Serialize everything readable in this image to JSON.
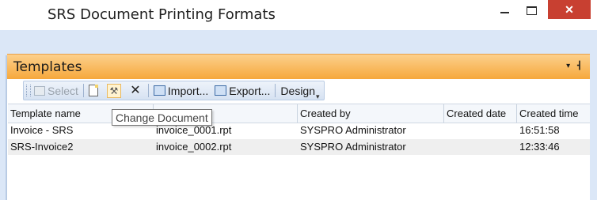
{
  "window": {
    "title": "SRS Document Printing Formats",
    "minimize_label": "",
    "maximize_label": "",
    "close_label": "✕"
  },
  "panel": {
    "title": "Templates",
    "pin_label": "▾ ⊢"
  },
  "toolbar": {
    "select_label": "Select",
    "import_label": "Import...",
    "export_label": "Export...",
    "design_label": "Design"
  },
  "tooltip": {
    "text": "Change Document"
  },
  "grid": {
    "columns": [
      "Template name",
      "",
      "Created by",
      "Created date",
      "Created time"
    ],
    "rows": [
      {
        "template_name": "Invoice - SRS",
        "file": "invoice_0001.rpt",
        "created_by": "SYSPRO Administrator",
        "created_date": "",
        "created_time": "16:51:58"
      },
      {
        "template_name": "SRS-Invoice2",
        "file": "invoice_0002.rpt",
        "created_by": "SYSPRO Administrator",
        "created_date": "",
        "created_time": "12:33:46"
      }
    ]
  },
  "icons": {
    "select": "select-icon",
    "new": "new-document-icon",
    "change": "change-document-icon",
    "delete": "delete-icon",
    "import": "import-icon",
    "export": "export-icon"
  },
  "colors": {
    "panel_header": "#f6a83c",
    "ribbon": "#dbe7f7",
    "close_button": "#c84031"
  }
}
